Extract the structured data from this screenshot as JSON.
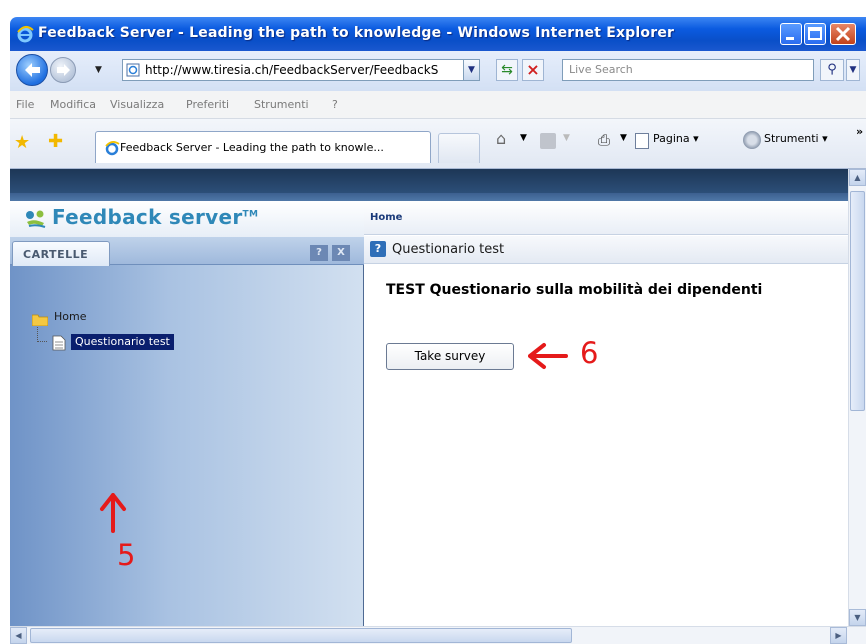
{
  "window": {
    "title": "Feedback Server - Leading the path to knowledge - Windows Internet Explorer"
  },
  "address_bar": {
    "url": "http://www.tiresia.ch/FeedbackServer/FeedbackS",
    "search_placeholder": "Live Search"
  },
  "menu": {
    "items": [
      "File",
      "Modifica",
      "Visualizza",
      "Preferiti",
      "Strumenti",
      "?"
    ]
  },
  "tabs": {
    "active_label": "Feedback Server - Leading the path to knowle..."
  },
  "command_bar": {
    "page_label": "Pagina ▾",
    "tools_label": "Strumenti ▾"
  },
  "app": {
    "logo_text": "Feedback server",
    "logo_tm": "TM",
    "folders_tab": "CARTELLE",
    "help_btn": "?",
    "close_btn": "X",
    "tree": {
      "home": "Home",
      "selected_item": "Questionario test"
    },
    "breadcrumb": "Home",
    "page_heading": "Questionario test",
    "survey_title": "TEST Questionario sulla mobilità dei dipendenti",
    "take_survey_button": "Take survey"
  },
  "annotations": {
    "step5": "5",
    "step6": "6",
    "color": "#e51a1a"
  },
  "colors": {
    "titlebar": "#0b5be0",
    "selection": "#0a1f6e",
    "logo": "#2f88b8"
  }
}
